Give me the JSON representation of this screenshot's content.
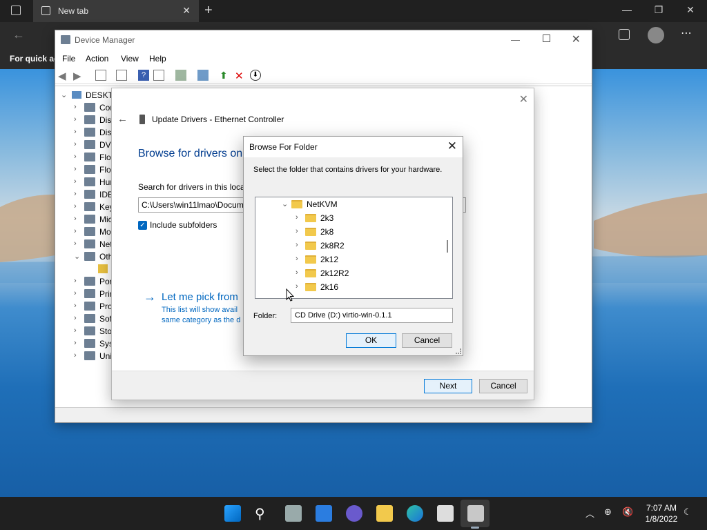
{
  "browser": {
    "tab_title": "New tab",
    "favbar_text": "For quick ac"
  },
  "device_manager": {
    "title": "Device Manager",
    "menu": [
      "File",
      "Action",
      "View",
      "Help"
    ],
    "tree_root": "DESKTO",
    "tree_items": [
      {
        "label": "Cor",
        "chevron": "›"
      },
      {
        "label": "Disk",
        "chevron": "›"
      },
      {
        "label": "Disp",
        "chevron": "›"
      },
      {
        "label": "DVD",
        "chevron": "›"
      },
      {
        "label": "Flop",
        "chevron": "›"
      },
      {
        "label": "Flop",
        "chevron": "›"
      },
      {
        "label": "Hum",
        "chevron": "›"
      },
      {
        "label": "IDE",
        "chevron": "›"
      },
      {
        "label": "Key",
        "chevron": "›"
      },
      {
        "label": "Mic",
        "chevron": "›"
      },
      {
        "label": "Mo",
        "chevron": "›"
      },
      {
        "label": "Net",
        "chevron": "›"
      },
      {
        "label": "Oth",
        "chevron": "⌄"
      },
      {
        "label": "",
        "chevron": ""
      },
      {
        "label": "Por",
        "chevron": "›"
      },
      {
        "label": "Prin",
        "chevron": "›"
      },
      {
        "label": "Pro",
        "chevron": "›"
      },
      {
        "label": "Soft",
        "chevron": "›"
      },
      {
        "label": "Stor",
        "chevron": "›"
      },
      {
        "label": "Syst",
        "chevron": "›"
      },
      {
        "label": "Uni",
        "chevron": "›"
      }
    ]
  },
  "wizard": {
    "heading": "Update Drivers - Ethernet Controller",
    "browse_title": "Browse for drivers on",
    "search_label": "Search for drivers in this locat",
    "path_value": "C:\\Users\\win11lmao\\Docum",
    "include_subfolders": "Include subfolders",
    "pick_title": "Let me pick from",
    "pick_desc_line1": "This list will show avail",
    "pick_desc_line2": "same category as the d",
    "next_label": "Next",
    "cancel_label": "Cancel"
  },
  "browse_folder": {
    "title": "Browse For Folder",
    "instruction": "Select the folder that contains drivers for your hardware.",
    "parent_folder": "NetKVM",
    "folders": [
      "2k3",
      "2k8",
      "2k8R2",
      "2k12",
      "2k12R2",
      "2k16"
    ],
    "folder_label": "Folder:",
    "folder_value": "CD Drive (D:) virtio-win-0.1.1",
    "ok_label": "OK",
    "cancel_label": "Cancel"
  },
  "taskbar": {
    "time": "7:07 AM",
    "date": "1/8/2022"
  },
  "colors": {
    "accent": "#0067c0",
    "folder": "#f2c94c",
    "taskbar": "#202020"
  }
}
